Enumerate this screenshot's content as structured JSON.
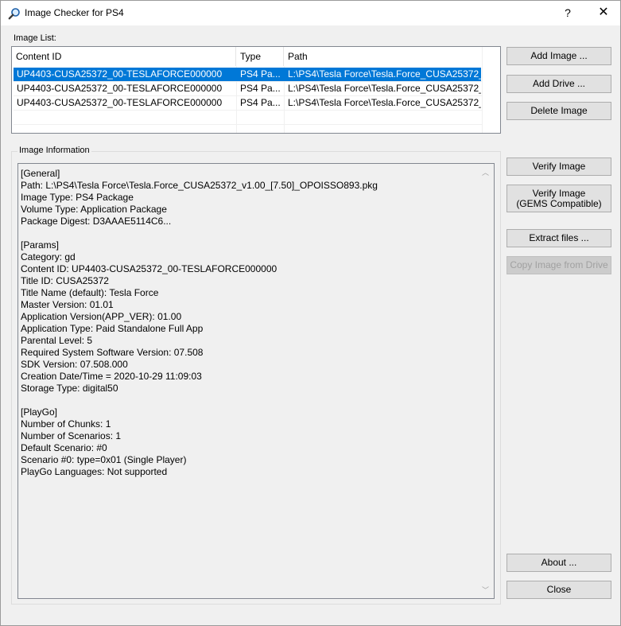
{
  "window": {
    "title": "Image Checker for PS4",
    "help_label": "?",
    "close_label": "✕"
  },
  "image_list": {
    "label": "Image List:",
    "columns": [
      "Content ID",
      "Type",
      "Path"
    ],
    "rows": [
      {
        "content_id": "UP4403-CUSA25372_00-TESLAFORCE000000",
        "type": "PS4 Pa...",
        "path": "L:\\PS4\\Tesla Force\\Tesla.Force_CUSA25372_...",
        "selected": true
      },
      {
        "content_id": "UP4403-CUSA25372_00-TESLAFORCE000000",
        "type": "PS4 Pa...",
        "path": "L:\\PS4\\Tesla Force\\Tesla.Force_CUSA25372_...",
        "selected": false
      },
      {
        "content_id": "UP4403-CUSA25372_00-TESLAFORCE000000",
        "type": "PS4 Pa...",
        "path": "L:\\PS4\\Tesla Force\\Tesla.Force_CUSA25372_...",
        "selected": false
      }
    ]
  },
  "image_info": {
    "label": "Image Information",
    "lines": [
      "[General]",
      "Path: L:\\PS4\\Tesla Force\\Tesla.Force_CUSA25372_v1.00_[7.50]_OPOISSO893.pkg",
      "Image Type: PS4 Package",
      "Volume Type: Application Package",
      "Package Digest: D3AAAE5114C6...",
      "",
      "[Params]",
      "Category: gd",
      "Content ID: UP4403-CUSA25372_00-TESLAFORCE000000",
      "Title ID: CUSA25372",
      "Title Name (default): Tesla Force",
      "Master Version: 01.01",
      "Application Version(APP_VER): 01.00",
      "Application Type: Paid Standalone Full App",
      "Parental Level: 5",
      "Required System Software Version: 07.508",
      "SDK Version: 07.508.000",
      "Creation Date/Time = 2020-10-29 11:09:03",
      "Storage Type: digital50",
      "",
      "[PlayGo]",
      "Number of Chunks: 1",
      "Number of Scenarios: 1",
      "Default Scenario: #0",
      "Scenario #0: type=0x01 (Single Player)",
      "PlayGo Languages: Not supported"
    ]
  },
  "buttons": {
    "add_image": "Add Image ...",
    "add_drive": "Add Drive ...",
    "delete_image": "Delete Image",
    "verify_image": "Verify Image",
    "verify_gems_line1": "Verify Image",
    "verify_gems_line2": "(GEMS Compatible)",
    "extract_files": "Extract files ...",
    "copy_from_drive": "Copy Image from Drive",
    "about": "About ...",
    "close": "Close"
  },
  "colors": {
    "selection": "#0078d7",
    "window_bg": "#f0f0f0"
  }
}
